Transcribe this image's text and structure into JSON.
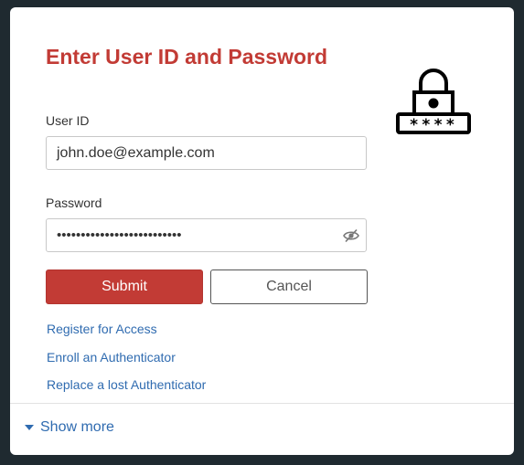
{
  "form": {
    "title": "Enter User ID and Password",
    "lock_icon": "padlock-with-password-icon",
    "lock_masked_text": "****",
    "userid_label": "User ID",
    "userid_value": "john.doe@example.com",
    "password_label": "Password",
    "password_masked": "••••••••••••••••••••••••••",
    "password_toggle_icon": "eye-slash-icon",
    "submit_label": "Submit",
    "cancel_label": "Cancel"
  },
  "links": {
    "register": "Register for Access",
    "enroll": "Enroll an Authenticator",
    "replace": "Replace a lost Authenticator"
  },
  "footer": {
    "show_more_label": "Show more",
    "show_more_icon": "caret-down-icon"
  },
  "colors": {
    "background": "#1f2a30",
    "accent_red": "#c23b35",
    "link_blue": "#2f6bb0"
  }
}
